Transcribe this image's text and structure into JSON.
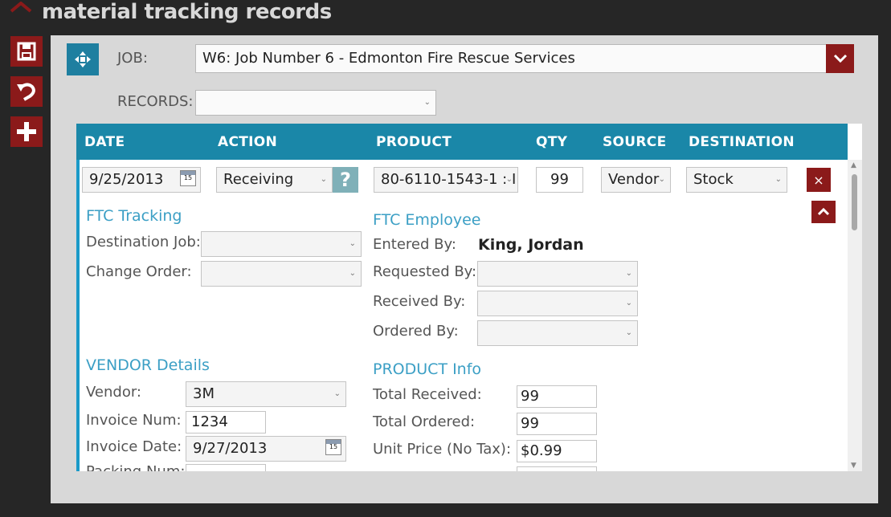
{
  "app": {
    "title": "material tracking records"
  },
  "toolbar": {
    "save": "save-icon",
    "undo": "undo-icon",
    "add": "plus-icon"
  },
  "job": {
    "label": "JOB:",
    "value": "W6: Job Number 6 - Edmonton Fire Rescue Services"
  },
  "records": {
    "label": "RECORDS:",
    "value": ""
  },
  "columns": [
    "DATE",
    "ACTION",
    "PRODUCT",
    "QTY",
    "SOURCE",
    "DESTINATION"
  ],
  "row": {
    "date": "9/25/2013",
    "action": "Receiving",
    "help": "?",
    "product": "80-6110-1543-1 : I",
    "qty": "99",
    "source": "Vendor",
    "destination": "Stock",
    "delete": "×"
  },
  "ftc_tracking": {
    "title": "FTC Tracking",
    "destination_job_label": "Destination Job:",
    "destination_job_value": "",
    "change_order_label": "Change Order:",
    "change_order_value": ""
  },
  "ftc_employee": {
    "title": "FTC Employee",
    "entered_by_label": "Entered By:",
    "entered_by_value": "King, Jordan",
    "requested_by_label": "Requested By:",
    "received_by_label": "Received By:",
    "ordered_by_label": "Ordered By:"
  },
  "vendor": {
    "title": "VENDOR Details",
    "vendor_label": "Vendor:",
    "vendor_value": "3M",
    "invoice_num_label": "Invoice Num:",
    "invoice_num_value": "1234",
    "invoice_date_label": "Invoice Date:",
    "invoice_date_value": "9/27/2013",
    "packing_num_label": "Packing Num:"
  },
  "product_info": {
    "title": "PRODUCT Info",
    "total_received_label": "Total Received:",
    "total_received_value": "99",
    "total_ordered_label": "Total Ordered:",
    "total_ordered_value": "99",
    "unit_price_label": "Unit Price (No Tax):",
    "unit_price_value": "$0.99"
  },
  "calendar": {
    "day": "15"
  },
  "colors": {
    "accent": "#1a87a8",
    "brand": "#8b1a1a",
    "bg": "#262626",
    "panel": "#d8d8d8"
  }
}
